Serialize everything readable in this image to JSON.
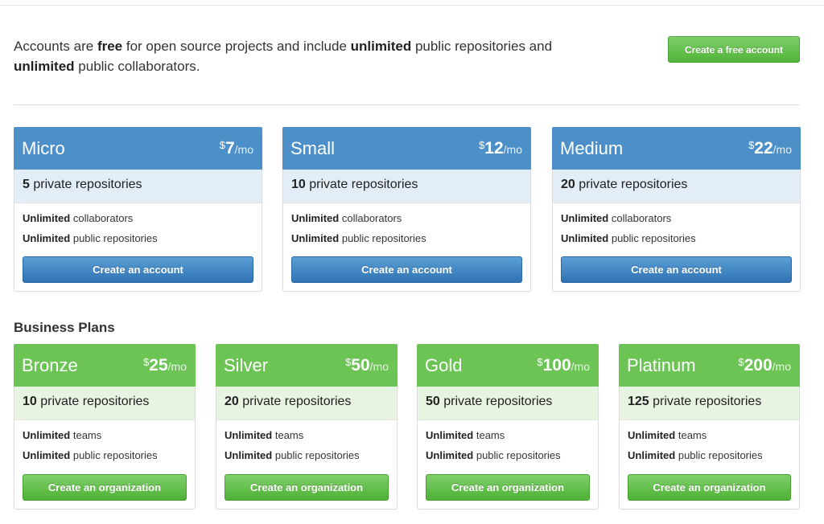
{
  "intro": {
    "p1": "Accounts are ",
    "b1": "free",
    "p2": " for open source projects and include ",
    "b2": "unlimited",
    "p3": " public repositories and ",
    "b3": "unlimited",
    "p4": " public collaborators."
  },
  "free_button": "Create a free account",
  "personal_plans": [
    {
      "name": "Micro",
      "currency": "$",
      "price": "7",
      "per": "/mo",
      "repos_count": "5",
      "repos_label": " private repositories",
      "features": [
        {
          "bold": "Unlimited",
          "text": " collaborators"
        },
        {
          "bold": "Unlimited",
          "text": " public repositories"
        }
      ],
      "button": "Create an account"
    },
    {
      "name": "Small",
      "currency": "$",
      "price": "12",
      "per": "/mo",
      "repos_count": "10",
      "repos_label": " private repositories",
      "features": [
        {
          "bold": "Unlimited",
          "text": " collaborators"
        },
        {
          "bold": "Unlimited",
          "text": " public repositories"
        }
      ],
      "button": "Create an account"
    },
    {
      "name": "Medium",
      "currency": "$",
      "price": "22",
      "per": "/mo",
      "repos_count": "20",
      "repos_label": " private repositories",
      "features": [
        {
          "bold": "Unlimited",
          "text": " collaborators"
        },
        {
          "bold": "Unlimited",
          "text": " public repositories"
        }
      ],
      "button": "Create an account"
    }
  ],
  "business_title": "Business Plans",
  "business_plans": [
    {
      "name": "Bronze",
      "currency": "$",
      "price": "25",
      "per": "/mo",
      "repos_count": "10",
      "repos_label": " private repositories",
      "features": [
        {
          "bold": "Unlimited",
          "text": " teams"
        },
        {
          "bold": "Unlimited",
          "text": " public repositories"
        }
      ],
      "button": "Create an organization"
    },
    {
      "name": "Silver",
      "currency": "$",
      "price": "50",
      "per": "/mo",
      "repos_count": "20",
      "repos_label": " private repositories",
      "features": [
        {
          "bold": "Unlimited",
          "text": " teams"
        },
        {
          "bold": "Unlimited",
          "text": " public repositories"
        }
      ],
      "button": "Create an organization"
    },
    {
      "name": "Gold",
      "currency": "$",
      "price": "100",
      "per": "/mo",
      "repos_count": "50",
      "repos_label": " private repositories",
      "features": [
        {
          "bold": "Unlimited",
          "text": " teams"
        },
        {
          "bold": "Unlimited",
          "text": " public repositories"
        }
      ],
      "button": "Create an organization"
    },
    {
      "name": "Platinum",
      "currency": "$",
      "price": "200",
      "per": "/mo",
      "repos_count": "125",
      "repos_label": " private repositories",
      "features": [
        {
          "bold": "Unlimited",
          "text": " teams"
        },
        {
          "bold": "Unlimited",
          "text": " public repositories"
        }
      ],
      "button": "Create an organization"
    }
  ],
  "colors": {
    "personal_header": "#4d90c9",
    "personal_band": "#e2edf7",
    "business_header": "#6cc455",
    "business_band": "#e6f4e1"
  }
}
